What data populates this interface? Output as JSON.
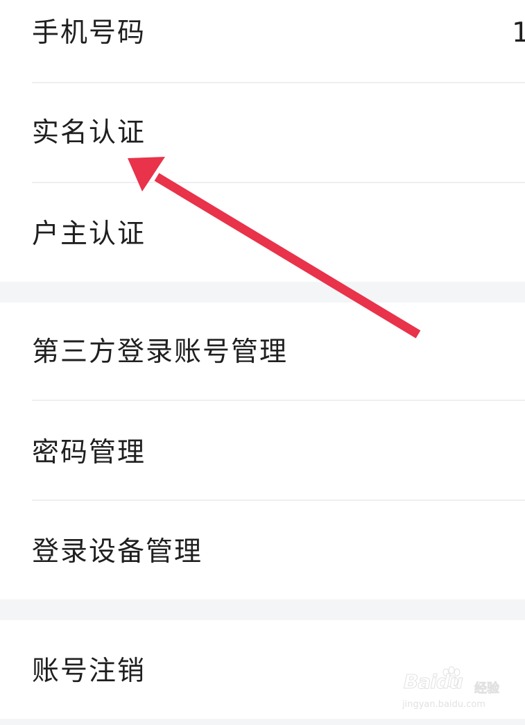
{
  "settings_list": {
    "group1": {
      "phone": {
        "label": "手机号码",
        "value": "1"
      },
      "real_name": {
        "label": "实名认证"
      },
      "household": {
        "label": "户主认证"
      }
    },
    "group2": {
      "third_party": {
        "label": "第三方登录账号管理"
      },
      "password": {
        "label": "密码管理"
      },
      "devices": {
        "label": "登录设备管理"
      }
    },
    "group3": {
      "cancel_account": {
        "label": "账号注销"
      }
    }
  },
  "annotation": {
    "arrow_color": "#e8334a",
    "points_to": "实名认证"
  },
  "watermark": {
    "logo": "Baidu",
    "sub": "经验",
    "url": "jingyan.baidu.com"
  },
  "colors": {
    "background": "#ffffff",
    "section_gap": "#f4f5f7",
    "divider": "#eeeff1",
    "text": "#1f1f1f"
  }
}
